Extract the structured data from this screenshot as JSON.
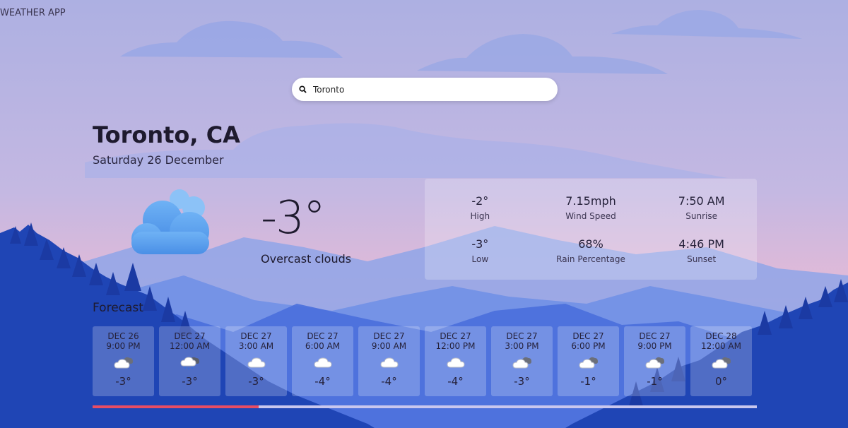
{
  "app": {
    "title": "WEATHER APP"
  },
  "search": {
    "value": "Toronto",
    "icon": "search-icon"
  },
  "location": {
    "city": "Toronto, CA",
    "date": "Saturday 26 December"
  },
  "current": {
    "temperature": "-3°",
    "description": "Overcast clouds",
    "icon": "cloud-icon"
  },
  "stats": [
    {
      "value": "-2°",
      "label": "High"
    },
    {
      "value": "7.15mph",
      "label": "Wind Speed"
    },
    {
      "value": "7:50 AM",
      "label": "Sunrise"
    },
    {
      "value": "-3°",
      "label": "Low"
    },
    {
      "value": "68%",
      "label": "Rain Percentage"
    },
    {
      "value": "4:46 PM",
      "label": "Sunset"
    }
  ],
  "forecast": {
    "title": "Forecast",
    "items": [
      {
        "date": "DEC 26",
        "time": "9:00 PM",
        "temp": "-3°",
        "icon": "broken-clouds-night"
      },
      {
        "date": "DEC 27",
        "time": "12:00 AM",
        "temp": "-3°",
        "icon": "snow-night"
      },
      {
        "date": "DEC 27",
        "time": "3:00 AM",
        "temp": "-3°",
        "icon": "cloud"
      },
      {
        "date": "DEC 27",
        "time": "6:00 AM",
        "temp": "-4°",
        "icon": "cloud"
      },
      {
        "date": "DEC 27",
        "time": "9:00 AM",
        "temp": "-4°",
        "icon": "cloud"
      },
      {
        "date": "DEC 27",
        "time": "12:00 PM",
        "temp": "-4°",
        "icon": "cloud"
      },
      {
        "date": "DEC 27",
        "time": "3:00 PM",
        "temp": "-3°",
        "icon": "broken-clouds"
      },
      {
        "date": "DEC 27",
        "time": "6:00 PM",
        "temp": "-1°",
        "icon": "broken-clouds"
      },
      {
        "date": "DEC 27",
        "time": "9:00 PM",
        "temp": "-1°",
        "icon": "broken-clouds"
      },
      {
        "date": "DEC 28",
        "time": "12:00 AM",
        "temp": "0°",
        "icon": "broken-clouds"
      }
    ]
  },
  "scroll_progress": 0.25,
  "colors": {
    "sky_top": "#b0b3e3",
    "sky_bottom": "#e3b9d4",
    "progress_fill": "#e84d64",
    "progress_track": "#c9c7ee",
    "mountain_dark": "#1f45b5",
    "cloud_blue": "#5aa3ee"
  }
}
